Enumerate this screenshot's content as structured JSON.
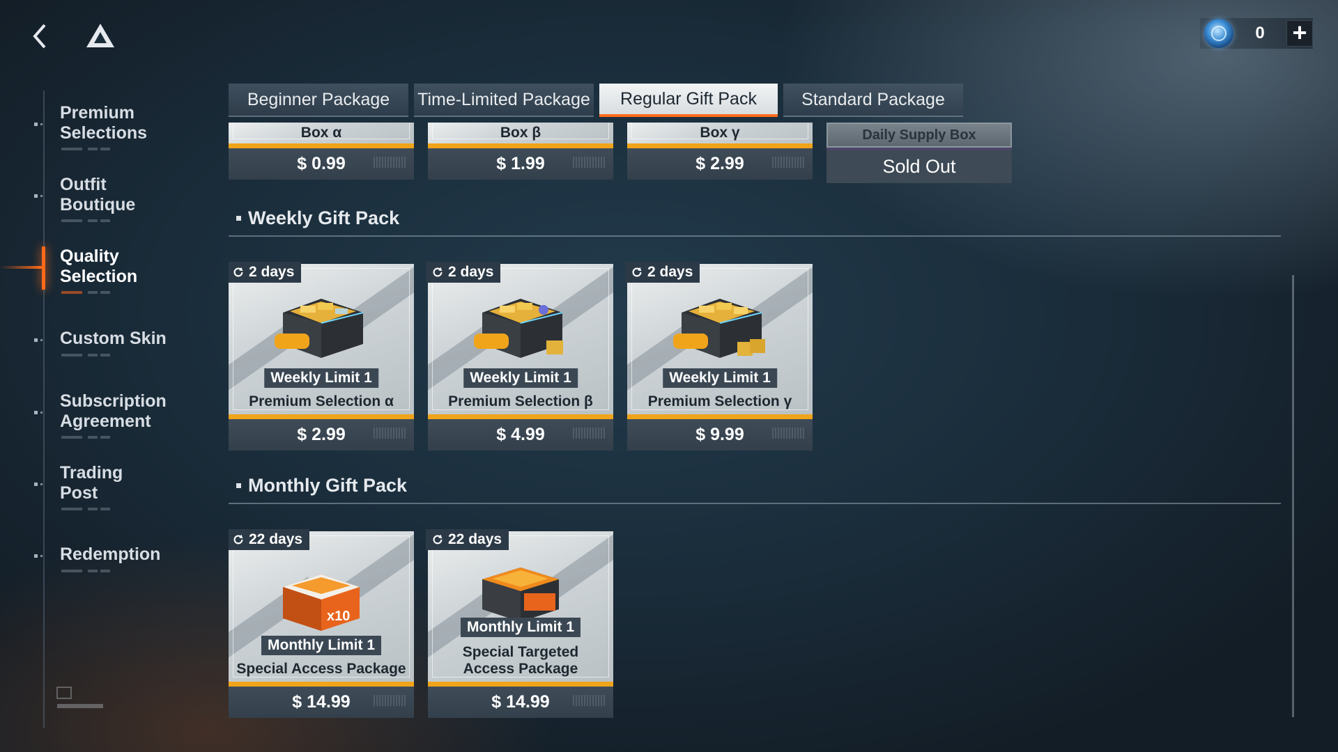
{
  "header": {
    "back_icon": "chevron-left-icon",
    "logo_icon": "triangle-logo-icon",
    "currency": {
      "icon": "blue-coin-icon",
      "value": "0",
      "add_label": "+"
    }
  },
  "sidebar": {
    "items": [
      {
        "label": "Premium Selections",
        "active": false
      },
      {
        "label": "Outfit Boutique",
        "active": false
      },
      {
        "label": "Quality Selection",
        "active": true
      },
      {
        "label": "Custom Skin",
        "active": false
      },
      {
        "label": "Subscription Agreement",
        "active": false
      },
      {
        "label": "Trading Post",
        "active": false
      },
      {
        "label": "Redemption",
        "active": false
      }
    ]
  },
  "tabs": [
    {
      "label": "Beginner Package",
      "active": false
    },
    {
      "label": "Time-Limited Package",
      "active": false
    },
    {
      "label": "Regular Gift Pack",
      "active": true
    },
    {
      "label": "Standard Package",
      "active": false
    }
  ],
  "top_row": {
    "cards": [
      {
        "name": "Box α",
        "price": "$ 0.99"
      },
      {
        "name": "Box β",
        "price": "$ 1.99"
      },
      {
        "name": "Box γ",
        "price": "$ 2.99"
      }
    ],
    "soldout": {
      "name": "Daily Supply Box",
      "status": "Sold Out"
    }
  },
  "weekly": {
    "title": "Weekly Gift Pack",
    "cards": [
      {
        "badge": "2 days",
        "limit": "Weekly Limit 1",
        "name": "Premium Selection α",
        "price": "$ 2.99"
      },
      {
        "badge": "2 days",
        "limit": "Weekly Limit 1",
        "name": "Premium Selection β",
        "price": "$ 4.99"
      },
      {
        "badge": "2 days",
        "limit": "Weekly Limit 1",
        "name": "Premium Selection γ",
        "price": "$ 9.99"
      }
    ]
  },
  "monthly": {
    "title": "Monthly Gift Pack",
    "cards": [
      {
        "badge": "22 days",
        "limit": "Monthly Limit 1",
        "name": "Special Access Package",
        "price": "$ 14.99"
      },
      {
        "badge": "22 days",
        "limit": "Monthly Limit 1",
        "name": "Special Targeted Access Package",
        "price": "$ 14.99"
      }
    ]
  },
  "colors": {
    "accent": "#ff6a1a",
    "price_stripe": "#f0a41a",
    "panel": "#3f4c58"
  }
}
